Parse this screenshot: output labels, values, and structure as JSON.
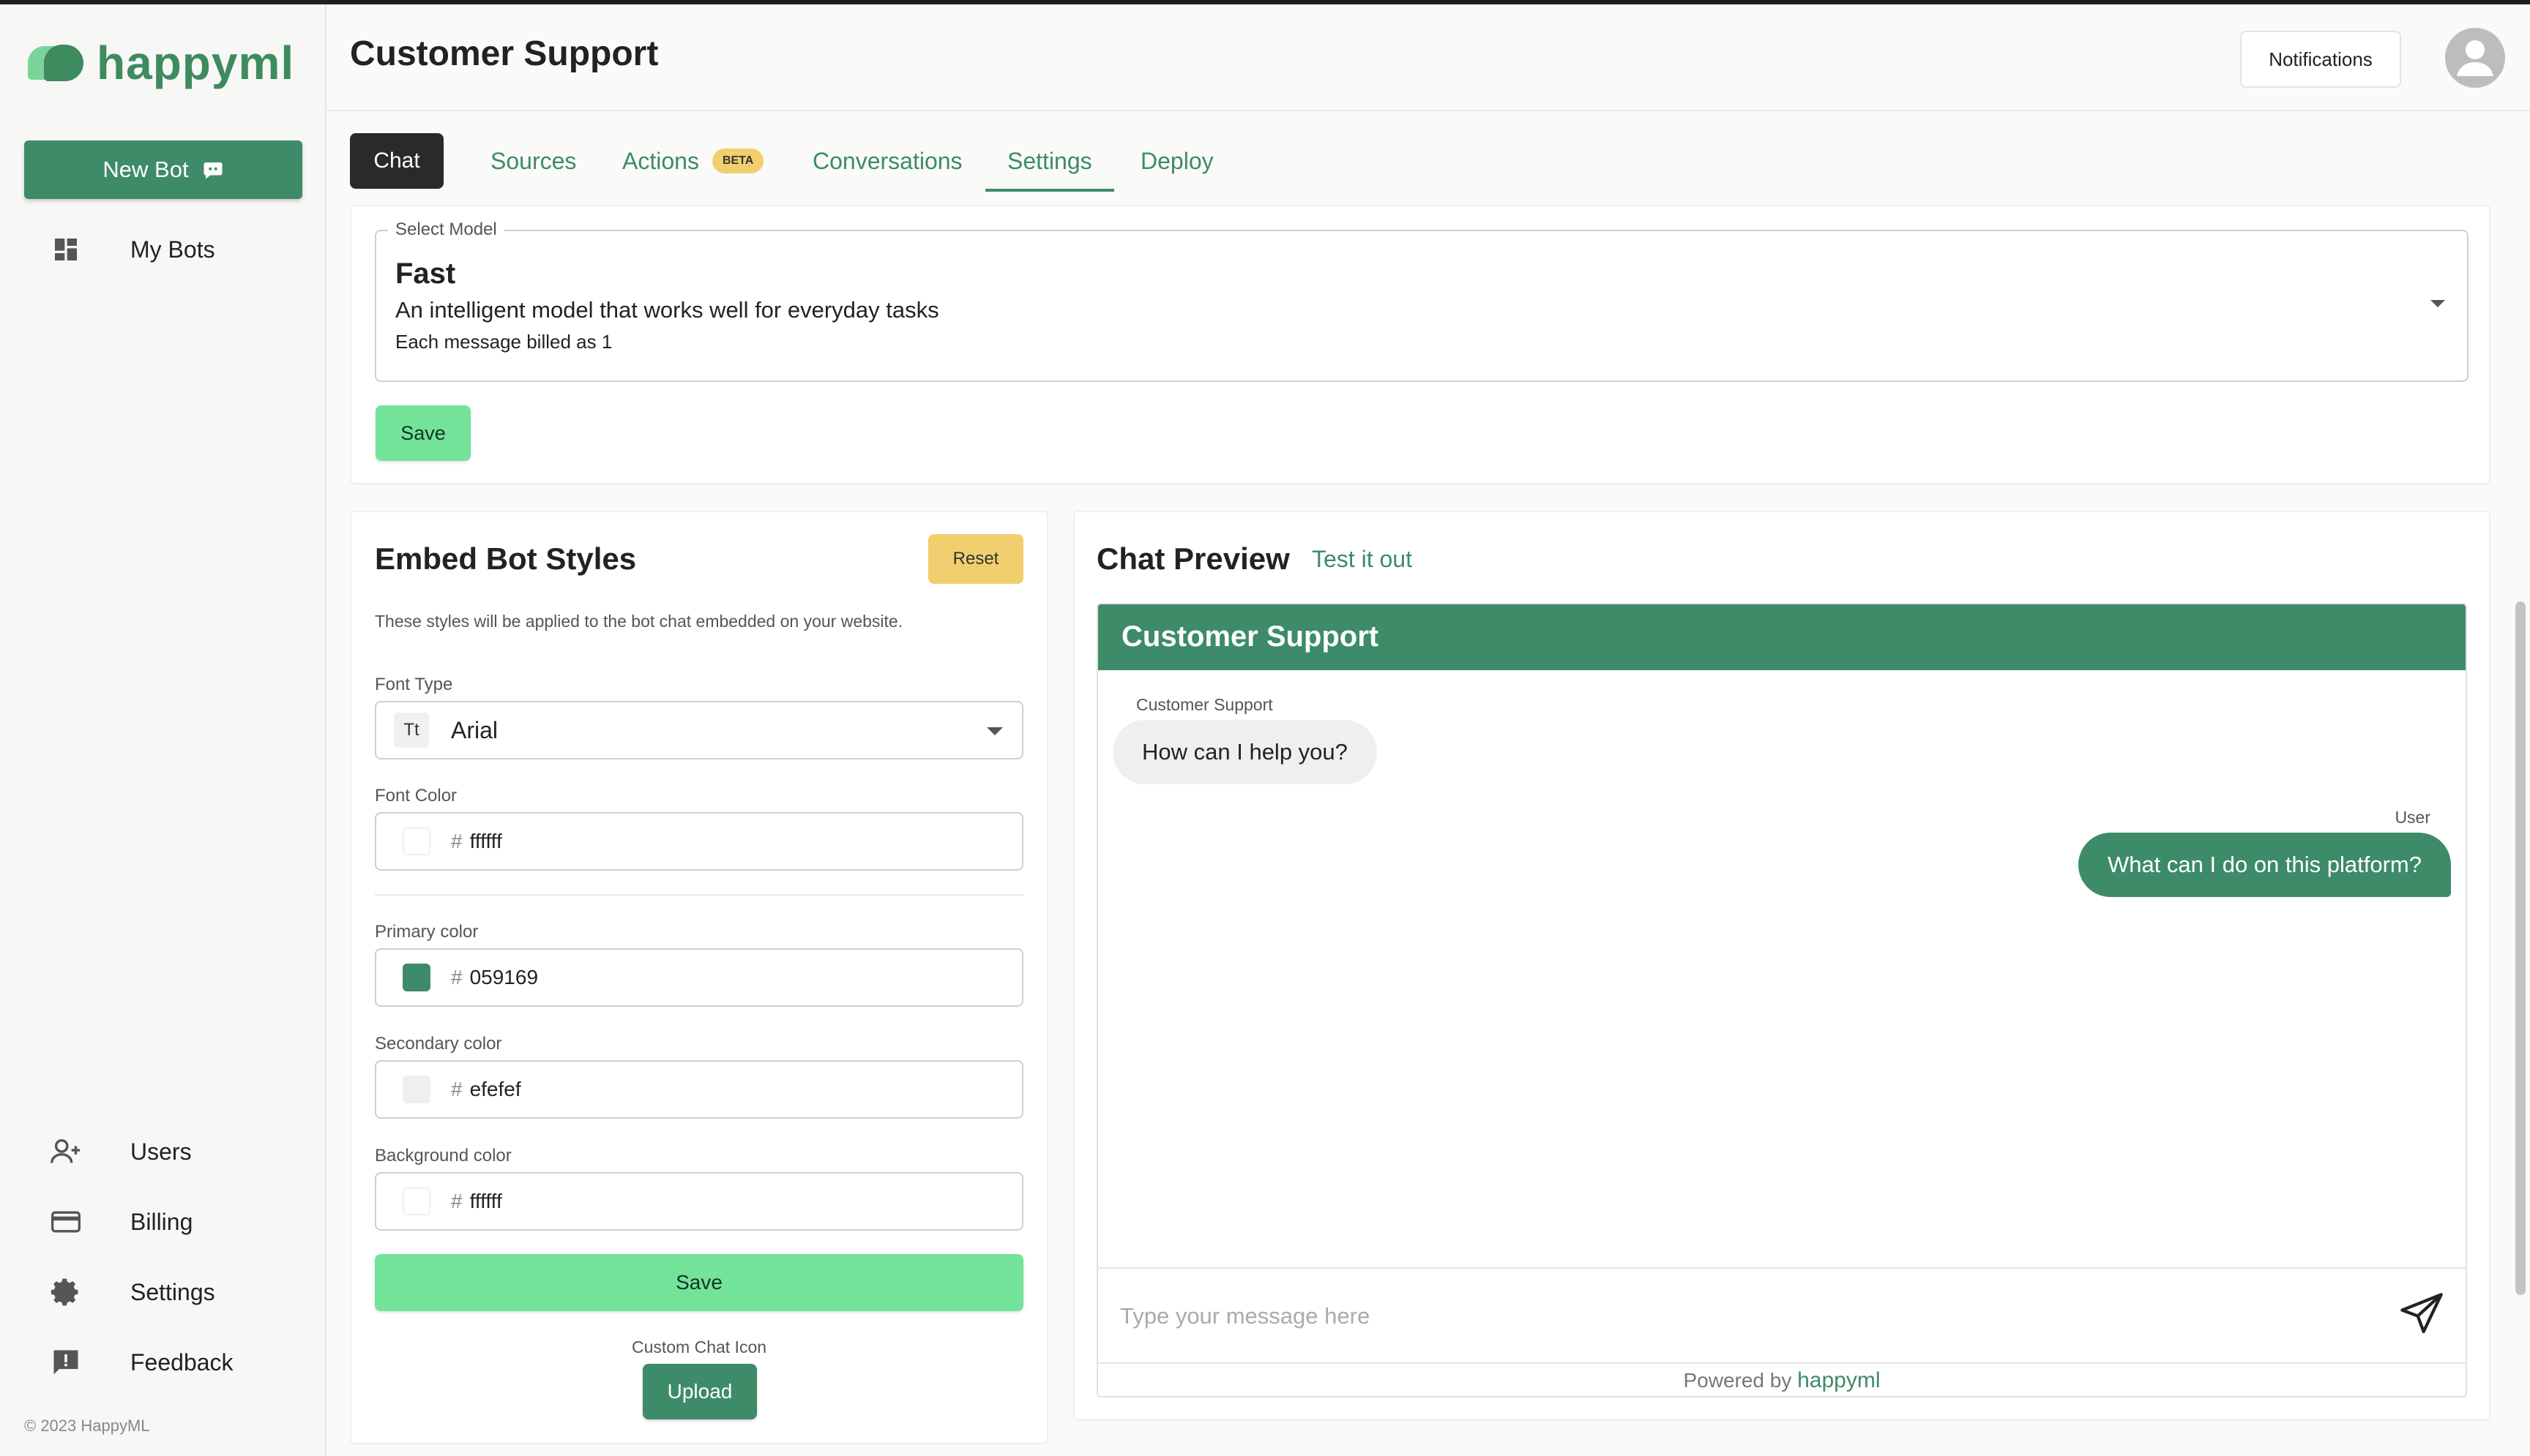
{
  "brand": {
    "name": "happyml",
    "accent": "#3d8b68",
    "light_accent": "#74e39a"
  },
  "sidebar": {
    "new_bot_label": "New Bot",
    "items": [
      {
        "label": "My Bots",
        "icon": "dashboard-icon"
      },
      {
        "label": "Users",
        "icon": "add-user-icon"
      },
      {
        "label": "Billing",
        "icon": "credit-card-icon"
      },
      {
        "label": "Settings",
        "icon": "gear-icon"
      },
      {
        "label": "Feedback",
        "icon": "feedback-icon"
      }
    ],
    "copyright": "© 2023 HappyML"
  },
  "header": {
    "title": "Customer Support",
    "notifications_label": "Notifications"
  },
  "tabs": [
    {
      "label": "Chat"
    },
    {
      "label": "Sources"
    },
    {
      "label": "Actions",
      "badge": "BETA"
    },
    {
      "label": "Conversations"
    },
    {
      "label": "Settings"
    },
    {
      "label": "Deploy"
    }
  ],
  "model": {
    "legend": "Select Model",
    "name": "Fast",
    "description": "An intelligent model that works well for everyday tasks",
    "billing": "Each message billed as 1",
    "save_label": "Save"
  },
  "embed": {
    "title": "Embed Bot Styles",
    "reset_label": "Reset",
    "description": "These styles will be applied to the bot chat embedded on your website.",
    "font_type_label": "Font Type",
    "font_type_icon": "Tt",
    "font_type_value": "Arial",
    "font_color_label": "Font Color",
    "font_color_value": "ffffff",
    "primary_label": "Primary color",
    "primary_value": "059169",
    "secondary_label": "Secondary color",
    "secondary_value": "efefef",
    "background_label": "Background color",
    "background_value": "ffffff",
    "hash": "#",
    "save_label": "Save",
    "custom_icon_label": "Custom Chat Icon",
    "upload_label": "Upload"
  },
  "preview": {
    "title": "Chat Preview",
    "test_link": "Test it out",
    "chat_title": "Customer Support",
    "bot_sender": "Customer Support",
    "bot_message": "How can I help you?",
    "user_sender": "User",
    "user_message": "What can I do on this platform?",
    "input_placeholder": "Type your message here",
    "powered_prefix": "Powered by",
    "powered_brand": "happyml"
  }
}
